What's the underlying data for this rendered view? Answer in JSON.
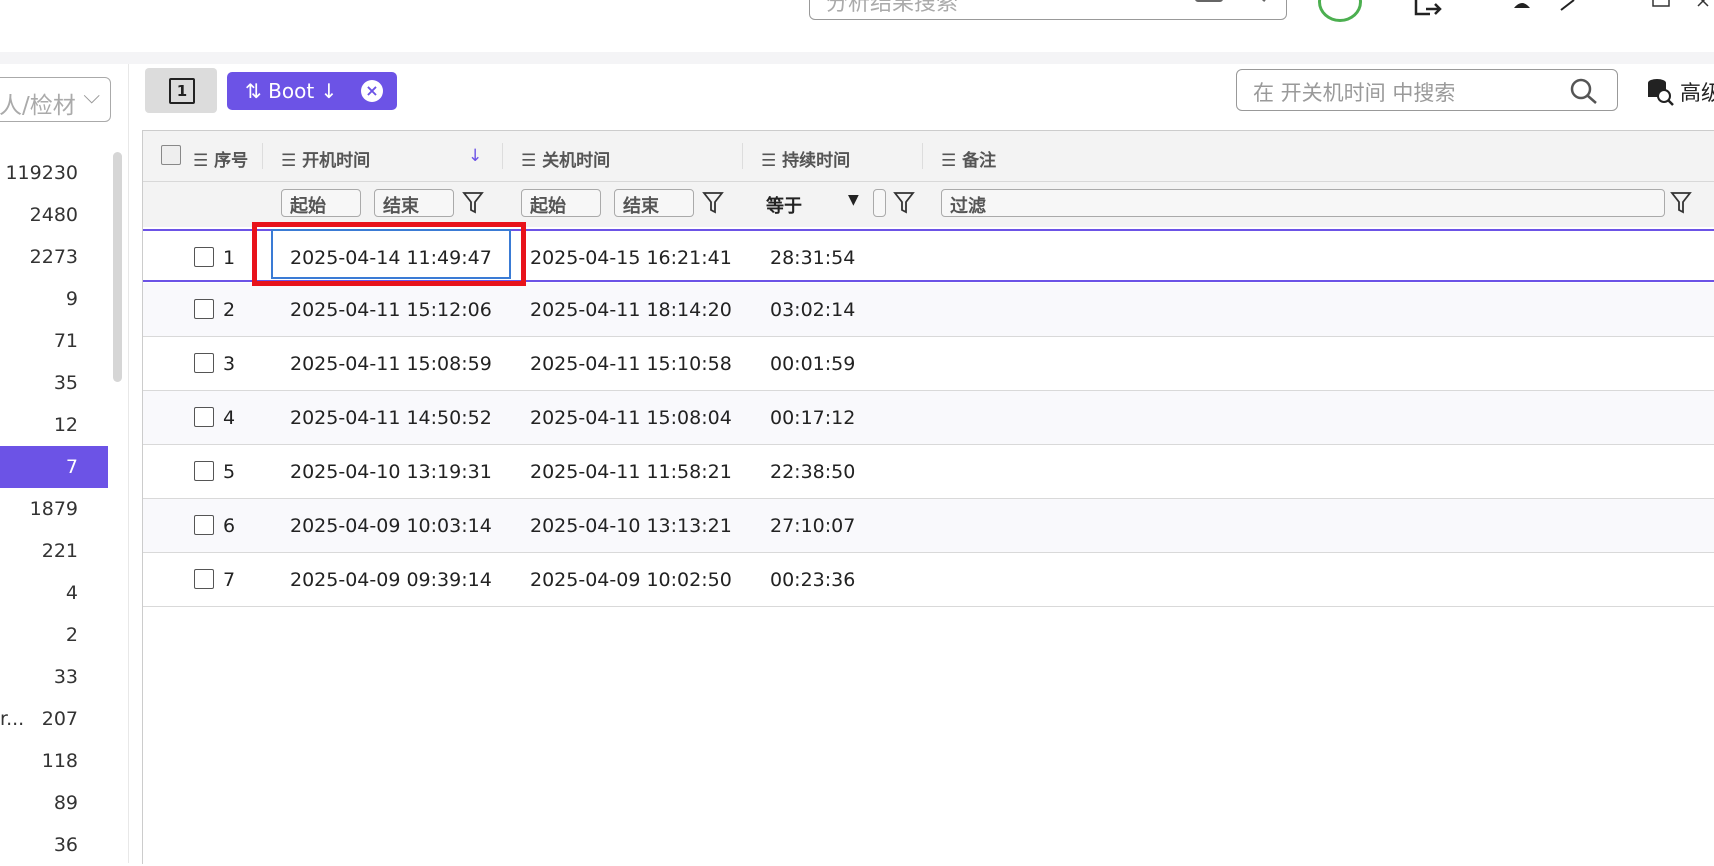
{
  "topbar": {
    "search_placeholder": "分析结果搜索"
  },
  "left_panel": {
    "select_value": "人/检材",
    "counts": [
      {
        "label": "",
        "value": "119230"
      },
      {
        "label": "",
        "value": "2480"
      },
      {
        "label": "",
        "value": "2273"
      },
      {
        "label": "",
        "value": "9"
      },
      {
        "label": "",
        "value": "71"
      },
      {
        "label": "",
        "value": "35"
      },
      {
        "label": "",
        "value": "12"
      },
      {
        "label": "",
        "value": "7",
        "selected": true
      },
      {
        "label": "",
        "value": "1879"
      },
      {
        "label": "",
        "value": "221"
      },
      {
        "label": "",
        "value": "4"
      },
      {
        "label": "",
        "value": "2"
      },
      {
        "label": "",
        "value": "33"
      },
      {
        "label": "r...",
        "value": "207"
      },
      {
        "label": "",
        "value": "118"
      },
      {
        "label": "",
        "value": "89"
      },
      {
        "label": "",
        "value": "36"
      }
    ]
  },
  "toolbar": {
    "tab_number": "1",
    "chip_label": "Boot",
    "search_placeholder": "在 开关机时间 中搜索",
    "advanced_label": "高级"
  },
  "table": {
    "columns": {
      "index": "序号",
      "boot_time": "开机时间",
      "shutdown_time": "关机时间",
      "duration": "持续时间",
      "notes": "备注"
    },
    "filters": {
      "start": "起始",
      "end": "结束",
      "equals": "等于",
      "filter": "过滤"
    },
    "rows": [
      {
        "index": "1",
        "boot": "2025-04-14 11:49:47",
        "shutdown": "2025-04-15 16:21:41",
        "duration": "28:31:54",
        "note": ""
      },
      {
        "index": "2",
        "boot": "2025-04-11 15:12:06",
        "shutdown": "2025-04-11 18:14:20",
        "duration": "03:02:14",
        "note": ""
      },
      {
        "index": "3",
        "boot": "2025-04-11 15:08:59",
        "shutdown": "2025-04-11 15:10:58",
        "duration": "00:01:59",
        "note": ""
      },
      {
        "index": "4",
        "boot": "2025-04-11 14:50:52",
        "shutdown": "2025-04-11 15:08:04",
        "duration": "00:17:12",
        "note": ""
      },
      {
        "index": "5",
        "boot": "2025-04-10 13:19:31",
        "shutdown": "2025-04-11 11:58:21",
        "duration": "22:38:50",
        "note": ""
      },
      {
        "index": "6",
        "boot": "2025-04-09 10:03:14",
        "shutdown": "2025-04-10 13:13:21",
        "duration": "27:10:07",
        "note": ""
      },
      {
        "index": "7",
        "boot": "2025-04-09 09:39:14",
        "shutdown": "2025-04-09 10:02:50",
        "duration": "00:23:36",
        "note": ""
      }
    ]
  },
  "colors": {
    "accent": "#6c53e6",
    "highlight_red": "#e8131b",
    "focus_blue": "#3a7bd5"
  }
}
